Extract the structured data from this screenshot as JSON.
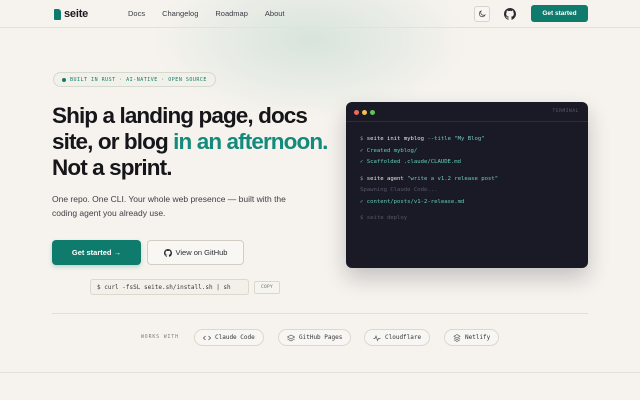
{
  "nav": {
    "logo_text": "seite",
    "links": [
      "Docs",
      "Changelog",
      "Roadmap",
      "About"
    ],
    "theme_icon": "moon-icon",
    "github_icon": "github-icon",
    "cta": "Get started"
  },
  "hero": {
    "badge": "BUILT IN RUST · AI-NATIVE · OPEN SOURCE",
    "headline_1": "Ship a landing page, docs site, or blog ",
    "headline_accent": "in an afternoon.",
    "headline_2": " Not a sprint.",
    "subtitle": "One repo. One CLI. Your whole web presence — built with the coding agent you already use.",
    "primary_button": "Get started →",
    "secondary_button": "View on GitHub",
    "install_command": "$ curl -fsSL seite.sh/install.sh | sh",
    "copy_label": "COPY"
  },
  "terminal": {
    "title": "TERMINAL",
    "lines": [
      {
        "prompt": "$ ",
        "cmd": "seite init myblog ",
        "arg": "--title \"My Blog\""
      },
      {
        "ok": "✓ Created myblog/"
      },
      {
        "ok": "✓ Scaffolded .claude/CLAUDE.md"
      },
      {
        "prompt": "$ ",
        "cmd": "seite agent ",
        "arg": "\"write a v1.2 release post\""
      },
      {
        "muted": "Spawning Claude Code..."
      },
      {
        "ok": "✓ content/posts/v1-2-release.md"
      },
      {
        "muted": "$ seite deploy"
      }
    ]
  },
  "works_with": {
    "label": "WORKS WITH",
    "items": [
      {
        "label": "Claude Code",
        "icon": "code-icon"
      },
      {
        "label": "GitHub Pages",
        "icon": "layers-icon"
      },
      {
        "label": "Cloudflare",
        "icon": "pulse-icon"
      },
      {
        "label": "Netlify",
        "icon": "stack-icon"
      }
    ]
  },
  "colors": {
    "accent": "#0f7b6c",
    "background": "#f6f3ee",
    "terminal_bg": "#1a1a27"
  }
}
